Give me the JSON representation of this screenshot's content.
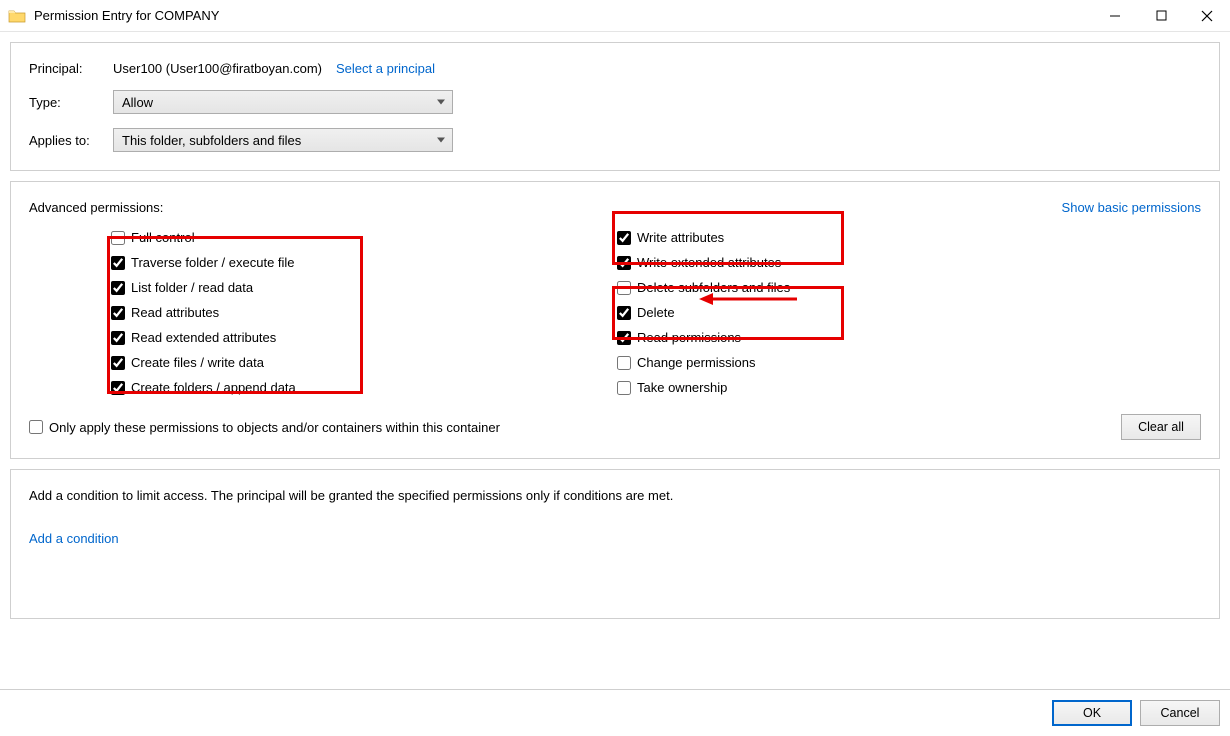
{
  "window": {
    "title": "Permission Entry for COMPANY"
  },
  "header": {
    "principal_label": "Principal:",
    "principal_value": "User100 (User100@firatboyan.com)",
    "select_principal": "Select a principal",
    "type_label": "Type:",
    "type_value": "Allow",
    "applies_label": "Applies to:",
    "applies_value": "This folder, subfolders and files"
  },
  "permissions": {
    "title": "Advanced permissions:",
    "show_basic": "Show basic permissions",
    "left": [
      {
        "label": "Full control",
        "checked": false
      },
      {
        "label": "Traverse folder / execute file",
        "checked": true
      },
      {
        "label": "List folder / read data",
        "checked": true
      },
      {
        "label": "Read attributes",
        "checked": true
      },
      {
        "label": "Read extended attributes",
        "checked": true
      },
      {
        "label": "Create files / write data",
        "checked": true
      },
      {
        "label": "Create folders / append data",
        "checked": true
      }
    ],
    "right": [
      {
        "label": "Write attributes",
        "checked": true
      },
      {
        "label": "Write extended attributes",
        "checked": true
      },
      {
        "label": "Delete subfolders and files",
        "checked": false
      },
      {
        "label": "Delete",
        "checked": true
      },
      {
        "label": "Read permissions",
        "checked": true
      },
      {
        "label": "Change permissions",
        "checked": false
      },
      {
        "label": "Take ownership",
        "checked": false
      }
    ],
    "only_apply": "Only apply these permissions to objects and/or containers within this container",
    "only_apply_checked": false,
    "clear_all": "Clear all"
  },
  "condition": {
    "description": "Add a condition to limit access. The principal will be granted the specified permissions only if conditions are met.",
    "add_link": "Add a condition"
  },
  "footer": {
    "ok": "OK",
    "cancel": "Cancel"
  }
}
